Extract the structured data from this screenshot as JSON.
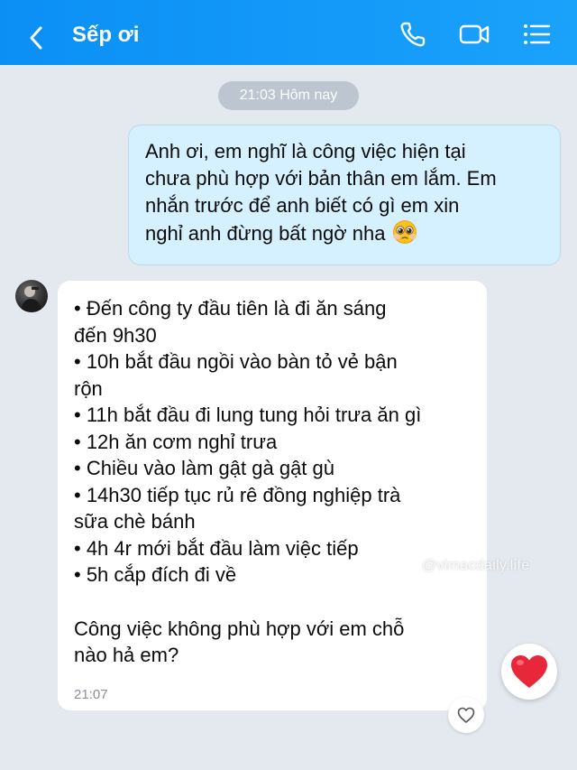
{
  "header": {
    "title": "Sếp ơi",
    "back_icon": "chevron-left-icon",
    "call_icon": "phone-icon",
    "video_icon": "video-camera-icon",
    "menu_icon": "list-menu-icon",
    "bg_color": "#1298f8"
  },
  "chat": {
    "date_separator": "21:03 Hôm nay",
    "outgoing": {
      "lines": [
        "Anh ơi, em nghĩ là công việc hiện tại",
        "chưa phù hợp với bản thân em lắm. Em",
        "nhắn trước để anh biết có gì em xin",
        "nghỉ anh đừng bất ngờ nha"
      ],
      "emoji": "pleading-face-icon",
      "bubble_color": "#d5f1ff"
    },
    "incoming": {
      "lines": [
        "• Đến công ty đầu tiên là đi ăn sáng",
        "đến 9h30",
        "• 10h bắt đầu ngồi vào bàn tỏ vẻ bận",
        "rộn",
        "• 11h bắt đầu đi lung tung hỏi trưa ăn gì",
        "• 12h ăn cơm nghỉ trưa",
        "• Chiều vào làm gật gà gật gù",
        "• 14h30 tiếp tục rủ rê đồng nghiệp trà",
        "sữa chè bánh",
        "• 4h 4r mới bắt đầu làm việc tiếp",
        "• 5h cắp đích đi về"
      ],
      "closing_lines": [
        "Công việc không phù hợp với em chỗ",
        "nào hả em?"
      ],
      "time": "21:07",
      "avatar_icon": "avatar",
      "reaction_small": "heart-outline-icon",
      "reaction_big": "red-heart-icon"
    },
    "watermark": "@vimacdaily.life"
  }
}
